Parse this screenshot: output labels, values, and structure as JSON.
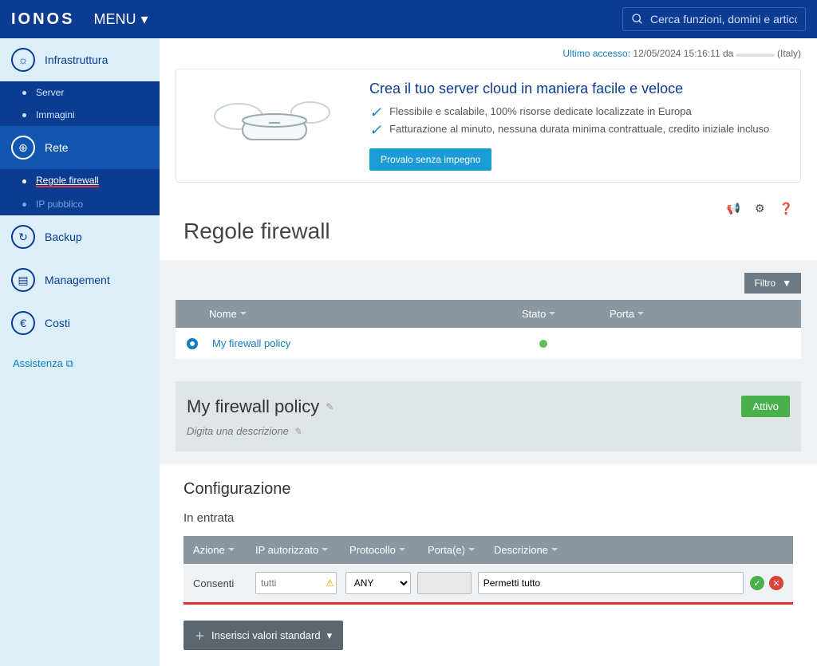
{
  "topbar": {
    "logo": "IONOS",
    "menu": "MENU",
    "search_placeholder": "Cerca funzioni, domini e articoli di su"
  },
  "sidebar": {
    "items": [
      {
        "label": "Infrastruttura"
      },
      {
        "label": "Server"
      },
      {
        "label": "Immagini"
      },
      {
        "label": "Rete"
      },
      {
        "label": "Regole firewall"
      },
      {
        "label": "IP pubblico"
      },
      {
        "label": "Backup"
      },
      {
        "label": "Management"
      },
      {
        "label": "Costi"
      }
    ],
    "assist": "Assistenza"
  },
  "last_access": {
    "label": "Ultimo accesso:",
    "value": "12/05/2024 15:16:11 da",
    "suffix": "(Italy)"
  },
  "promo": {
    "title": "Crea il tuo server cloud in maniera facile e veloce",
    "bullets": [
      "Flessibile e scalabile, 100% risorse dedicate localizzate in Europa",
      "Fatturazione al minuto, nessuna durata minima contrattuale, credito iniziale incluso"
    ],
    "cta": "Provalo senza impegno"
  },
  "page": {
    "title": "Regole firewall",
    "filter": "Filtro"
  },
  "table": {
    "cols": {
      "name": "Nome",
      "stato": "Stato",
      "porta": "Porta"
    },
    "rows": [
      {
        "name": "My firewall policy"
      }
    ]
  },
  "policy": {
    "title": "My firewall policy",
    "desc_placeholder": "Digita una descrizione",
    "badge": "Attivo"
  },
  "config": {
    "title": "Configurazione",
    "subtitle": "In entrata",
    "cols": {
      "azione": "Azione",
      "ip": "IP autorizzato",
      "protocollo": "Protocollo",
      "porte": "Porta(e)",
      "descrizione": "Descrizione"
    },
    "row": {
      "azione": "Consenti",
      "ip_placeholder": "tutti",
      "protocollo": "ANY",
      "descrizione": "Permetti tutto"
    },
    "std_btn": "Inserisci valori standard"
  }
}
